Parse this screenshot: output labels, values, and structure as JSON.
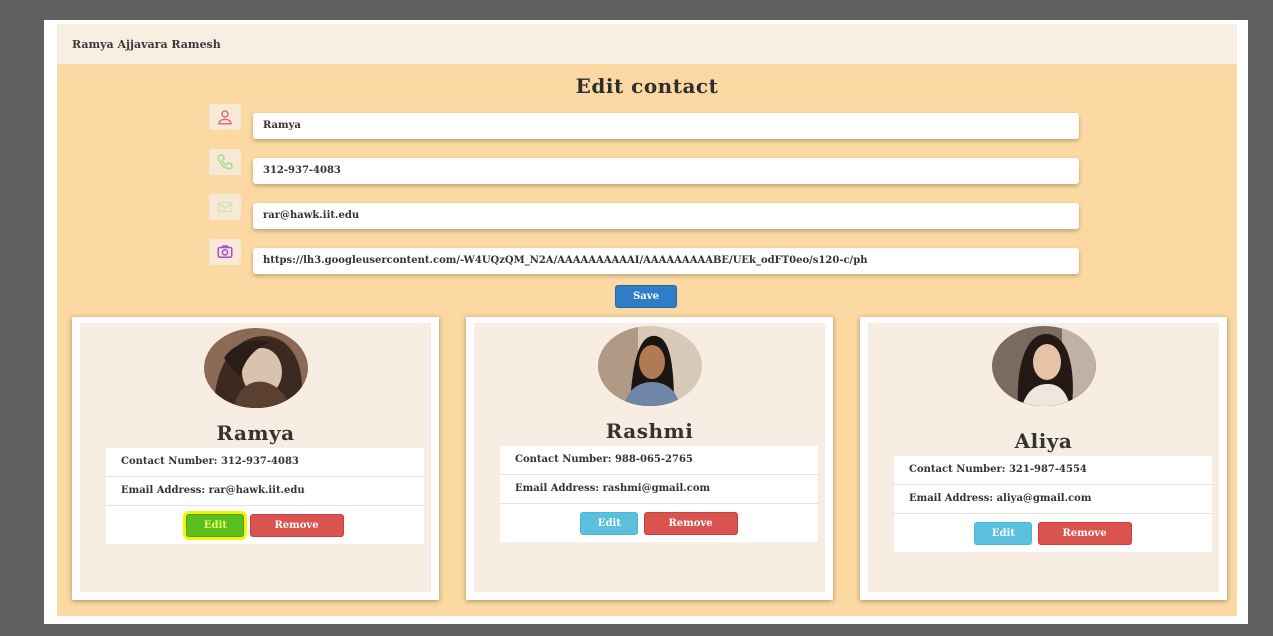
{
  "header": {
    "user_name": "Ramya Ajjavara Ramesh"
  },
  "form": {
    "title": "Edit contact",
    "name_value": "Ramya",
    "phone_value": "312-937-4083",
    "email_value": "rar@hawk.iit.edu",
    "photo_url_value": "https://lh3.googleusercontent.com/-W4UQzQM_N2A/AAAAAAAAAAI/AAAAAAAAABE/UEk_odFT0eo/s120-c/ph",
    "save_label": "Save",
    "icons": [
      "user-icon",
      "phone-icon",
      "email-icon",
      "camera-icon"
    ]
  },
  "contacts": [
    {
      "name": "Ramya",
      "contact_number": "Contact Number: 312-937-4083",
      "email": "Email Address: rar@hawk.iit.edu",
      "edit_label": "Edit",
      "remove_label": "Remove",
      "edit_highlighted": true
    },
    {
      "name": "Rashmi",
      "contact_number": "Contact Number: 988-065-2765",
      "email": "Email Address: rashmi@gmail.com",
      "edit_label": "Edit",
      "remove_label": "Remove",
      "edit_highlighted": false
    },
    {
      "name": "Aliya",
      "contact_number": "Contact Number: 321-987-4554",
      "email": "Email Address: aliya@gmail.com",
      "edit_label": "Edit",
      "remove_label": "Remove",
      "edit_highlighted": false
    }
  ],
  "colors": {
    "background": "#fcd9a2",
    "header": "#f9eee2",
    "card": "#f8ede2",
    "save": "#2f7dc6",
    "edit": "#5bc0de",
    "remove": "#d9534f",
    "highlight": "#f5f500"
  }
}
